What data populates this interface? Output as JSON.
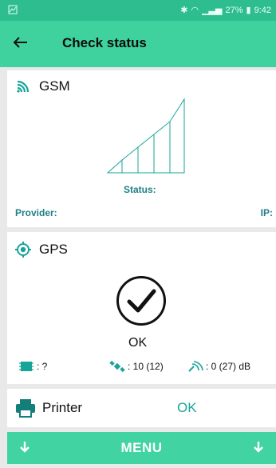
{
  "status_bar": {
    "battery_percent": "27%",
    "time": "9:42"
  },
  "app_bar": {
    "title": "Check status"
  },
  "gsm": {
    "title": "GSM",
    "status_label": "Status:",
    "provider_label": "Provider:",
    "ip_label": "IP:",
    "signal_level": 5
  },
  "gps": {
    "title": "GPS",
    "state": "OK",
    "storage": ": ?",
    "satellites": ": 10 (12)",
    "signal": ": 0 (27) dB"
  },
  "printer": {
    "label": "Printer",
    "state": "OK"
  },
  "menu": {
    "label": "MENU"
  },
  "colors": {
    "accent": "#3fd29f",
    "status_bar": "#2dbd8e",
    "teal_text": "#1f7f88",
    "ok_text": "#19a49a"
  }
}
